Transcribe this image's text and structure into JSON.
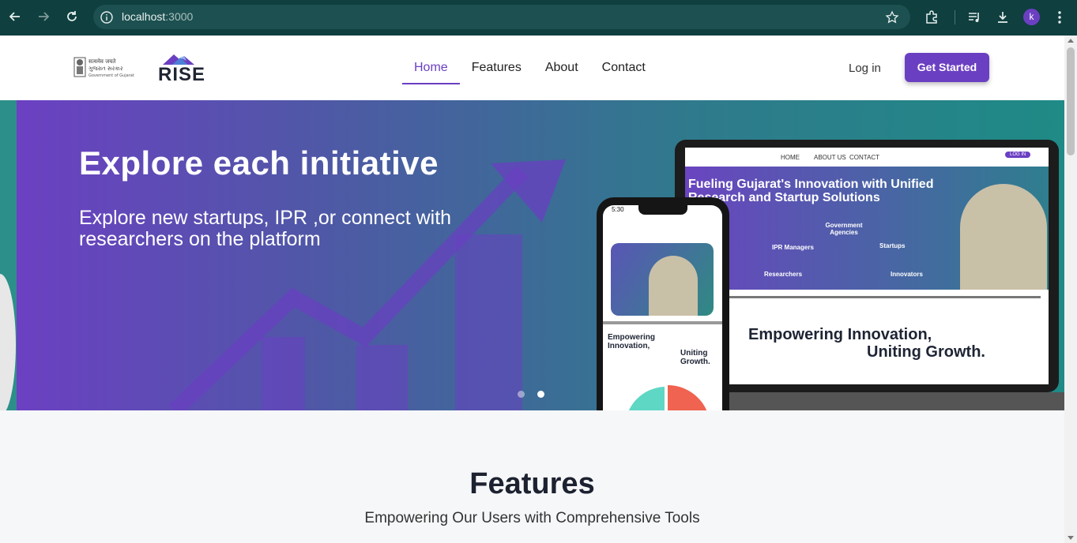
{
  "browser": {
    "url_host": "localhost",
    "url_port": ":3000",
    "profile_initial": "k"
  },
  "header": {
    "nav": [
      "Home",
      "Features",
      "About",
      "Contact"
    ],
    "active_nav": "Home",
    "login_label": "Log in",
    "cta_label": "Get Started",
    "brand_name": "RISE",
    "gov_logo_text": "सत्यमेव जयते ગુજરાત સરકાર Government of Gujarat"
  },
  "hero": {
    "title": "Explore each initiative",
    "subtitle": "Explore new startups, IPR ,or connect with researchers on the platform",
    "slide_count": 2,
    "active_slide": 2
  },
  "laptop_mock": {
    "nav": [
      "HOME",
      "ABOUT US",
      "CONTACT"
    ],
    "login": "LOG IN",
    "headline": "Fueling Gujarat's Innovation with Unified Research and Startup Solutions",
    "labels": [
      "Government Agencies",
      "IPR Managers",
      "Startups",
      "Researchers",
      "Innovators"
    ],
    "tagline_1": "Empowering Innovation,",
    "tagline_2": "Uniting Growth."
  },
  "phone_mock": {
    "time": "5:30",
    "tagline_1": "Empowering Innovation,",
    "tagline_2": "Uniting Growth."
  },
  "features": {
    "title": "Features",
    "subtitle": "Empowering Our Users with Comprehensive Tools"
  },
  "colors": {
    "brand": "#6b3fc2",
    "chrome": "#0f3f3f"
  }
}
